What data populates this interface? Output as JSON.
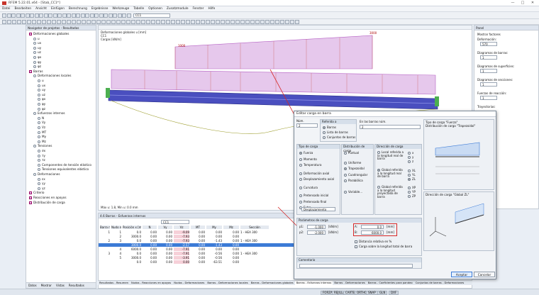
{
  "window": {
    "title": "RFEM 5.22.01.x64 - [Stab_CC1*]",
    "minimize": "—",
    "maximize": "□",
    "close": "✕"
  },
  "menu": [
    "Datei",
    "Bearbeiten",
    "Ansicht",
    "Einfügen",
    "Berechnung",
    "Ergebnisse",
    "Werkzeuge",
    "Tabelle",
    "Optionen",
    "Zusatzmodule",
    "Fenster",
    "Hilfe"
  ],
  "toolbar": {
    "loadcase": "CC1"
  },
  "navigator": {
    "title": "Navigator de projetos - Resultados",
    "items": [
      {
        "label": "Deformaciones globales",
        "level": 0
      },
      {
        "label": "u",
        "level": 1
      },
      {
        "label": "ux",
        "level": 1
      },
      {
        "label": "uy",
        "level": 1
      },
      {
        "label": "uz",
        "level": 1
      },
      {
        "label": "φx",
        "level": 1
      },
      {
        "label": "φy",
        "level": 1
      },
      {
        "label": "φz",
        "level": 1
      },
      {
        "label": "Barras",
        "level": 0
      },
      {
        "label": "Deformaciones locales",
        "level": 1
      },
      {
        "label": "u",
        "level": 2
      },
      {
        "label": "ux",
        "level": 2
      },
      {
        "label": "uy",
        "level": 2
      },
      {
        "label": "uz",
        "level": 2
      },
      {
        "label": "φx",
        "level": 2
      },
      {
        "label": "φy",
        "level": 2
      },
      {
        "label": "φz",
        "level": 2
      },
      {
        "label": "Esfuerzos internos",
        "level": 1
      },
      {
        "label": "N",
        "level": 2
      },
      {
        "label": "Vy",
        "level": 2
      },
      {
        "label": "Vz",
        "level": 2
      },
      {
        "label": "MT",
        "level": 2
      },
      {
        "label": "My",
        "level": 2
      },
      {
        "label": "Mz",
        "level": 2
      },
      {
        "label": "Tensiones",
        "level": 1
      },
      {
        "label": "σx",
        "level": 2
      },
      {
        "label": "τy",
        "level": 2
      },
      {
        "label": "τz",
        "level": 2
      },
      {
        "label": "Componentes de tensión elástico",
        "level": 2
      },
      {
        "label": "Tensiones equivalentes elástico",
        "level": 2
      },
      {
        "label": "Deformaciones",
        "level": 1
      },
      {
        "label": "εx",
        "level": 2
      },
      {
        "label": "γy",
        "level": 2
      },
      {
        "label": "γz",
        "level": 2
      },
      {
        "label": "Criterio",
        "level": 0
      },
      {
        "label": "Reacciones en apoyos",
        "level": 0
      },
      {
        "label": "Distribución de carga",
        "level": 0
      }
    ],
    "tabs": [
      "Datos",
      "Mostrar",
      "Vistas",
      "Resultados"
    ]
  },
  "view": {
    "line1": "Deformaciones globales u [mm]",
    "line2": "CC1",
    "line3": "Cargas [kN/m]",
    "footer": "Máx u: 1.8, Mín u: 0.0 mm",
    "load_label_start": "1000",
    "load_label_end": "3000"
  },
  "panel": {
    "title": "Panel",
    "show_factors": "Mostrar factores",
    "deformation_label": "Deformación:",
    "deformation_value": "570",
    "bars_label": "Diagramas de barras:",
    "bars_value": "1",
    "surfaces_label": "Diagramas de superficies:",
    "surfaces_value": "1",
    "sections_label": "Diagramas de secciones:",
    "sections_value": "1",
    "reactions_label": "Fuerzas de reacción:",
    "reactions_value": "1",
    "paths_label": "Trayectorias:"
  },
  "table": {
    "title": "4.6 Barras - Esfuerzos internos",
    "loadcase": "CC1",
    "headers": [
      "Barra núm.",
      "Nudo núm.",
      "Posición x [mm]",
      "N",
      "Vy",
      "Vz",
      "MT",
      "My",
      "Mz",
      "Sección"
    ],
    "rows": [
      [
        "1",
        "1",
        "0.0",
        "0.00",
        "0.00",
        "-9.09",
        "0.00",
        "0.00",
        "0.00",
        "1 - HEA 300"
      ],
      [
        "",
        "2",
        "3000.0",
        "0.00",
        "0.00",
        "-7.93",
        "0.00",
        "0.00",
        "0.00",
        ""
      ],
      [
        "2",
        "3",
        "0.0",
        "0.00",
        "0.00",
        "-7.93",
        "0.00",
        "-1.43",
        "0.00",
        "1 - HEA 300"
      ],
      [
        "",
        "",
        "3000.0",
        "0.00",
        "0.00",
        "-2.57",
        "0.00",
        "-1.43",
        "0.00",
        ""
      ],
      [
        "",
        "4",
        "6000.0",
        "0.00",
        "0.00",
        "-7.91",
        "0.00",
        "0.00",
        "0.00",
        ""
      ],
      [
        "3",
        "4",
        "0.0",
        "0.00",
        "0.00",
        "-7.91",
        "0.00",
        "-0.56",
        "0.00",
        "1 - HEA 300"
      ],
      [
        "",
        "5",
        "3000.0",
        "0.00",
        "0.00",
        "-3.91",
        "0.00",
        "-0.56",
        "0.00",
        ""
      ],
      [
        "",
        "",
        "0.0",
        "0.00",
        "0.00",
        "0.00",
        "0.00",
        "-63.51",
        "0.00",
        ""
      ]
    ],
    "tabs": [
      "Resultados - Resumen",
      "Nudos - Reacciones en apoyos",
      "Nudos - Deformaciones",
      "Barras - Deformaciones locales",
      "Barras - Deformaciones globales",
      "Barras - Esfuerzos internos",
      "Barras - Deformaciones",
      "Barras - Coeficientes para pandeo",
      "Conjuntos de barras - Deformaciones"
    ]
  },
  "status": [
    "FORZAR",
    "REJILLA",
    "CARTES",
    "ORTHO",
    "SNAP",
    "GLN",
    "DXF"
  ],
  "dialog": {
    "title": "Editar carga en barra",
    "no_label": "Núm.",
    "no_value": "2",
    "refer_title": "Referida a",
    "refer_options": [
      "Barras",
      "Lista de barras",
      "Conjuntos de barras"
    ],
    "onbars_label": "En las barras núm.",
    "onbars_value": "2",
    "loadtype_title": "Tipo de carga",
    "loadtypes": [
      "Fuerza",
      "Momento",
      "Temperatura",
      "Deformación axial",
      "Desplazamiento axial",
      "Curvatura",
      "Pretensado inicial",
      "Pretensado final",
      "Extra"
    ],
    "loadtype_extra_select": "Desplazamiento",
    "dist_title": "Distribución de carga",
    "dists": [
      "Puntual",
      "Uniforme",
      "Trapezoidal",
      "Cuadrangular",
      "Parabólica",
      "Variable..."
    ],
    "dir_title": "Dirección de carga",
    "dir_local": "Local referida a la longitud real de barra",
    "dir_global1": "Global referida a la longitud real de barra",
    "dir_global2": "Global referida a la longitud proyectada de barra",
    "dir_local_opts": [
      "x",
      "y",
      "z"
    ],
    "dir_global_opts": [
      "XL",
      "YL",
      "ZL"
    ],
    "dir_proj_opts": [
      "XP",
      "YP",
      "ZP"
    ],
    "preview_title1": "Tipo de carga \"Fuerza\"",
    "preview_title2": "Distribución de carga \"Trapezoidal\"",
    "preview_dir_title": "Dirección de carga \"Global ZL\"",
    "params_title": "Parámetros de carga",
    "p1_label": "p1:",
    "p1_value": "-1.000",
    "p1_unit": "[kN/m]",
    "p2_label": "p2:",
    "p2_value": "-2.000",
    "p2_unit": "[kN/m]",
    "a_label": "A:",
    "a_value": "0.0",
    "a_unit": "[mm]",
    "b_label": "B:",
    "b_value": "6000.0",
    "b_unit": "[mm]",
    "rel_dist": "Distancia relativa en %",
    "over_total": "Carga sobre la longitud total de barra",
    "comment_title": "Comentario",
    "ok": "Aceptar",
    "cancel": "Cancelar"
  },
  "colors": {
    "accent": "#3c7bd6",
    "load": "#d6a8e0",
    "beam": "#3a3fa0",
    "highlight": "#d62828"
  }
}
